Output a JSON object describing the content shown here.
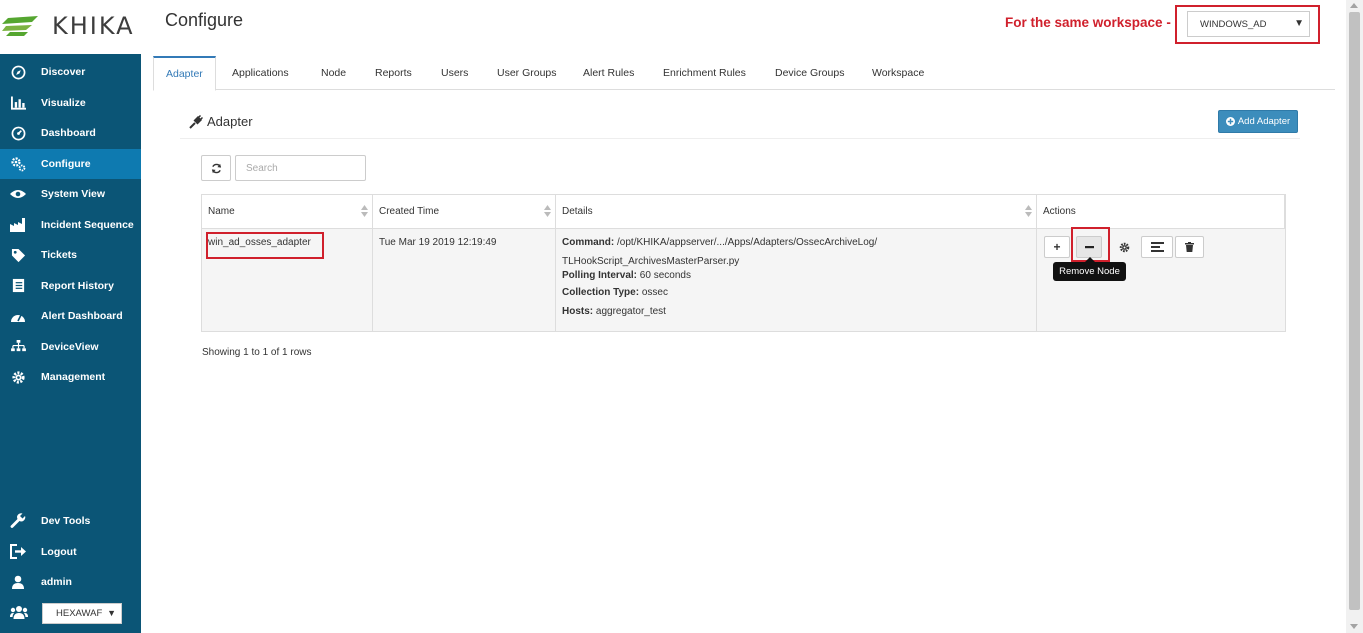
{
  "brand": {
    "logo_text": "KHIKA"
  },
  "sidebar": {
    "items": [
      {
        "label": "Discover",
        "icon": "compass-icon"
      },
      {
        "label": "Visualize",
        "icon": "bar-chart-icon"
      },
      {
        "label": "Dashboard",
        "icon": "dashboard-icon"
      },
      {
        "label": "Configure",
        "icon": "gears-icon",
        "active": true
      },
      {
        "label": "System View",
        "icon": "eye-icon"
      },
      {
        "label": "Incident Sequence",
        "icon": "factory-icon"
      },
      {
        "label": "Tickets",
        "icon": "tag-icon"
      },
      {
        "label": "Report History",
        "icon": "report-icon"
      },
      {
        "label": "Alert Dashboard",
        "icon": "gauge-icon"
      },
      {
        "label": "DeviceView",
        "icon": "sitemap-icon"
      },
      {
        "label": "Management",
        "icon": "gear-icon"
      }
    ],
    "bottom_items": [
      {
        "label": "Dev Tools",
        "icon": "wrench-icon"
      },
      {
        "label": "Logout",
        "icon": "logout-icon"
      },
      {
        "label": "admin",
        "icon": "user-icon"
      }
    ],
    "workspace_select": {
      "value": "HEXAWAF"
    }
  },
  "header": {
    "title": "Configure",
    "note": "For the same workspace -",
    "workspace_value": "WINDOWS_AD"
  },
  "tabs": [
    {
      "label": "Adapter",
      "active": true
    },
    {
      "label": "Applications"
    },
    {
      "label": "Node"
    },
    {
      "label": "Reports"
    },
    {
      "label": "Users"
    },
    {
      "label": "User Groups"
    },
    {
      "label": "Alert Rules"
    },
    {
      "label": "Enrichment Rules"
    },
    {
      "label": "Device Groups"
    },
    {
      "label": "Workspace"
    }
  ],
  "section": {
    "title": "Adapter",
    "add_button": "Add Adapter",
    "search_placeholder": "Search"
  },
  "table": {
    "columns": [
      "Name",
      "Created Time",
      "Details",
      "Actions"
    ],
    "rows": [
      {
        "name": "win_ad_osses_adapter",
        "created": "Tue Mar 19 2019 12:19:49",
        "command_label": "Command:",
        "command_value": "/opt/KHIKA/appserver/.../Apps/Adapters/OssecArchiveLog/",
        "command_value_2": "TLHookScript_ArchivesMasterParser.py",
        "polling_label": "Polling Interval:",
        "polling_value": "60 seconds",
        "collection_label": "Collection Type:",
        "collection_value": "ossec",
        "hosts_label": "Hosts:",
        "hosts_value": "aggregator_test"
      }
    ],
    "tooltip": "Remove Node",
    "footer": "Showing 1 to 1 of 1 rows"
  },
  "colors": {
    "sidebar_bg": "#0b5576",
    "sidebar_active": "#0e7ab0",
    "accent": "#337ab7",
    "highlight": "#d0202c"
  }
}
